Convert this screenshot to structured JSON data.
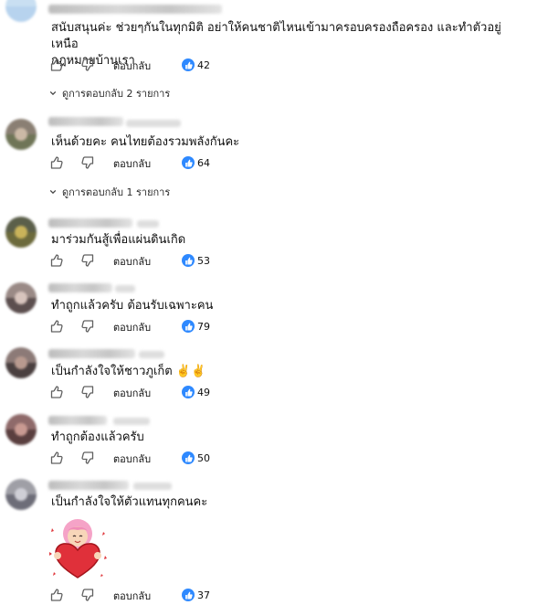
{
  "reply_label": "ตอบกลับ",
  "comments": [
    {
      "text": "สนับสนุนค่ะ ช่วยๆกันในทุกมิติ อย่าให้คนชาติไหนเข้ามาครอบครองถือครอง และทำตัวอยู่เหนือ\nกฎหมายบ้านเรา",
      "likes": "42",
      "replies_label": "ดูการตอบกลับ 2 รายการ",
      "avatar": "blurred-user-photo"
    },
    {
      "text": "เห็นด้วยคะ คนไทยต้องรวมพลังกันคะ",
      "likes": "64",
      "replies_label": "ดูการตอบกลับ 1 รายการ",
      "avatar": "blurred-user-photo"
    },
    {
      "text": "มาร่วมกันสู้เพื่อแผ่นดินเกิด",
      "likes": "53",
      "avatar": "blurred-user-photo"
    },
    {
      "text": "ทำถูกแล้วครับ ต้อนรับเฉพาะคน",
      "likes": "79",
      "avatar": "blurred-user-photo"
    },
    {
      "text": "เป็นกำลังใจให้ชาวภูเก็ต",
      "emoji": "✌️✌️",
      "likes": "49",
      "avatar": "blurred-user-photo"
    },
    {
      "text": "ทำถูกต้องแล้วครับ",
      "likes": "50",
      "avatar": "blurred-user-photo"
    },
    {
      "text": "เป็นกำลังใจให้ตัวแทนทุกคนคะ",
      "sticker": "girl-hugging-heart-sticker",
      "likes": "37",
      "avatar": "blurred-user-photo"
    }
  ],
  "colors": {
    "like_badge": "#2e89ff",
    "text": "#0f0f0f",
    "icon": "#606060"
  },
  "icons": {
    "like": "thumb-up-icon",
    "dislike": "thumb-down-icon",
    "chevron": "chevron-down-icon"
  }
}
